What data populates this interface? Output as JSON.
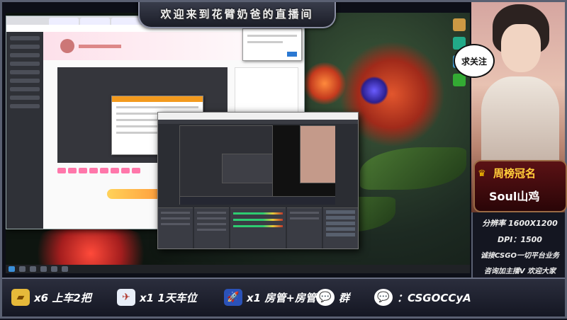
{
  "banner": {
    "title": "欢迎来到花臂奶爸的直播间"
  },
  "follow_bubble": {
    "label": "求关注"
  },
  "weekly_badge": {
    "title": "周榜冠名",
    "name": "Soul山鸡"
  },
  "stream_info": {
    "resolution": "分辨率 1600X1200",
    "dpi": "DPI：1500",
    "business": "诚接CSGO一切平台业务",
    "contact": "咨询加主播V  欢迎大家"
  },
  "bottom_bar": {
    "items": [
      {
        "icon": "ticket-icon",
        "label": "x6 上车2把"
      },
      {
        "icon": "plane-icon",
        "label": "x1 1天车位"
      },
      {
        "icon": "rocket-icon",
        "label": "x1 房管+房管"
      },
      {
        "icon": "wechat-icon",
        "label": "群"
      },
      {
        "icon": "wechat-icon",
        "label": "：CSGOCCyA"
      }
    ]
  },
  "colors": {
    "accent": "#ffd23a",
    "badge_bg": "#5b1215",
    "orange": "#f39a1e"
  }
}
